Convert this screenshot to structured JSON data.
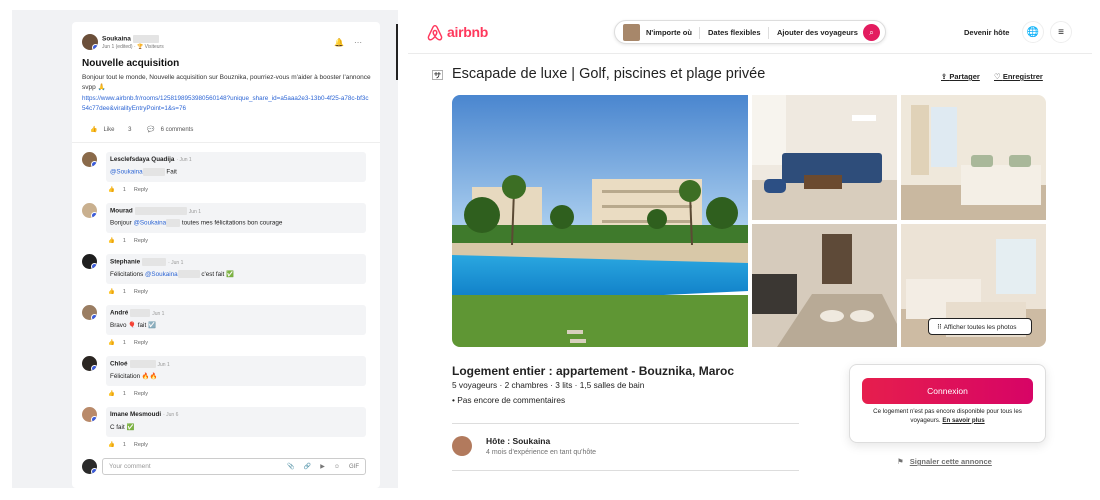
{
  "post": {
    "author": "Soukaina",
    "meta": "Jun 1 (edited) · 🏆 Visiteurs",
    "title": "Nouvelle acquisition",
    "body": "Bonjour tout le monde, Nouvelle acquisition sur Bouznika, pourriez-vous m'aider à booster l'annonce svpp 🙏",
    "link": "https://www.airbnb.fr/rooms/1258198953980560148?unique_share_id=a5aaa2e3-13b0-4f25-a78c-bf3c54c77dee&viralityEntryPoint=1&s=76",
    "like_label": "Like",
    "like_count": "3",
    "comments_label": "6 comments",
    "comments": [
      {
        "name": "Lesclefsdaya Quadija",
        "date": "· Jun 1",
        "pre": "",
        "mention": "@Soukaina",
        "text": " Fait",
        "likes": "1",
        "reply": "Reply"
      },
      {
        "name": "Mourad",
        "date": "Jun 1",
        "pre": "Bonjour ",
        "mention": "@Soukaina",
        "text": " toutes mes félicitations bon courage",
        "likes": "1",
        "reply": "Reply"
      },
      {
        "name": "Stephanie",
        "date": "· Jun 1",
        "pre": "Félicitations ",
        "mention": "@Soukaina",
        "text": " c'est fait ✅",
        "likes": "1",
        "reply": "Reply"
      },
      {
        "name": "André",
        "date": "Jun 1",
        "pre": "",
        "mention": "",
        "text": "Bravo 🎈 fait ☑️",
        "likes": "1",
        "reply": "Reply"
      },
      {
        "name": "Chloé",
        "date": "Jun 1",
        "pre": "",
        "mention": "",
        "text": "Félicitation 🔥🔥",
        "likes": "1",
        "reply": "Reply"
      },
      {
        "name": "Imane Mesmoudi",
        "date": "· Jun 6",
        "pre": "",
        "mention": "",
        "text": "C fait ✅",
        "likes": "1",
        "reply": "Reply"
      }
    ],
    "comment_placeholder": "Your comment"
  },
  "airbnb": {
    "logo": "airbnb",
    "search": {
      "where": "N'importe où",
      "when": "Dates flexibles",
      "who": "Ajouter des voyageurs"
    },
    "become_host": "Devenir hôte",
    "title": "Escapade de luxe | Golf, piscines et plage privée",
    "share": "Partager",
    "save": "Enregistrer",
    "show_photos": "Afficher toutes les photos",
    "subtitle": "Logement entier : appartement - Bouznika, Maroc",
    "details": "5 voyageurs · 2 chambres · 3 lits · 1,5 salles de bain",
    "reviews": "• Pas encore de commentaires",
    "host_name": "Hôte : Soukaina",
    "host_exp": "4 mois d'expérience en tant qu'hôte",
    "login_button": "Connexion",
    "availability_note": "Ce logement n'est pas encore disponible pour tous les voyageurs.",
    "learn_more": "En savoir plus",
    "report": "Signaler cette annonce",
    "brand_color": "#ff385c"
  }
}
